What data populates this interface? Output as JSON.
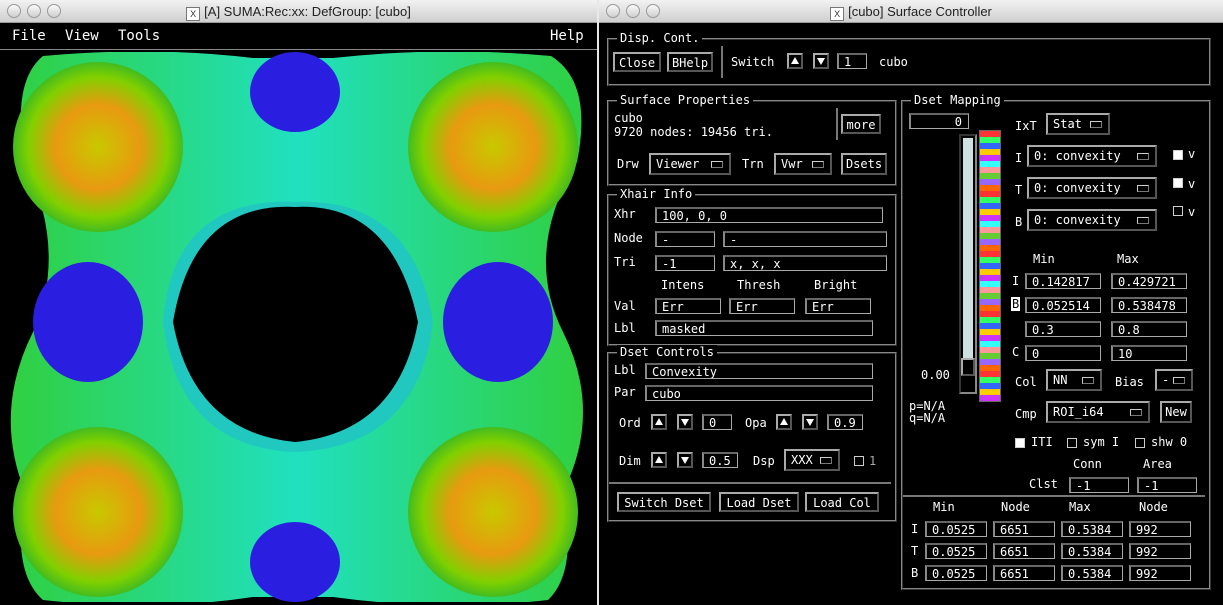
{
  "viewer": {
    "title": "[A] SUMA:Rec:xx: DefGroup: [cubo]",
    "menu": {
      "file": "File",
      "view": "View",
      "tools": "Tools",
      "help": "Help"
    }
  },
  "controller": {
    "title": "[cubo] Surface Controller",
    "disp": {
      "label": "Disp. Cont.",
      "close": "Close",
      "bhelp": "BHelp",
      "switch": "Switch",
      "index": "1",
      "name": "cubo"
    },
    "props": {
      "label": "Surface Properties",
      "surf": "cubo",
      "info": "9720 nodes: 19456 tri.",
      "more": "more",
      "drw": "Drw",
      "drw_val": "Viewer",
      "trn": "Trn",
      "trn_val": "Vwr",
      "dsets": "Dsets"
    },
    "xhair": {
      "label": "Xhair Info",
      "xhr": "Xhr",
      "xhr_val": "100, 0, 0",
      "node": "Node",
      "node_val": "-",
      "node_val2": "-",
      "tri": "Tri",
      "tri_val": "-1",
      "tri_val2": "x, x, x",
      "intens": "Intens",
      "thresh": "Thresh",
      "bright": "Bright",
      "val": "Val",
      "err1": "Err",
      "err2": "Err",
      "err3": "Err",
      "lbl": "Lbl",
      "lbl_val": "masked"
    },
    "dsetc": {
      "label": "Dset Controls",
      "lbl": "Lbl",
      "lbl_val": "Convexity",
      "par": "Par",
      "par_val": "cubo",
      "ord": "Ord",
      "ord_val": "0",
      "opa": "Opa",
      "opa_val": "0.9",
      "dim": "Dim",
      "dim_val": "0.5",
      "dsp": "Dsp",
      "dsp_val": "XXX",
      "one": "1",
      "switch_dset": "Switch Dset",
      "load_dset": "Load Dset",
      "load_col": "Load Col"
    },
    "map": {
      "label": "Dset Mapping",
      "top_val": "0",
      "zero": "0.00",
      "p": "p=N/A",
      "q": "q=N/A",
      "ixt": "IxT",
      "ixt_val": "Stat",
      "i": "I",
      "t": "T",
      "b": "B",
      "conv": "0: convexity",
      "v": "v",
      "min": "Min",
      "max": "Max",
      "i_min": "0.142817",
      "i_max": "0.429721",
      "b_min": "0.052514",
      "b_max": "0.538478",
      "r3_min": "0.3",
      "r3_max": "0.8",
      "c": "C",
      "c_min": "0",
      "c_max": "10",
      "col": "Col",
      "col_val": "NN",
      "bias": "Bias",
      "bias_val": "-",
      "cmp": "Cmp",
      "cmp_val": "ROI_i64",
      "new": "New",
      "iti": "ITI",
      "symi": "sym I",
      "shw0": "shw 0",
      "conn": "Conn",
      "area": "Area",
      "clst": "Clst",
      "clst1": "-1",
      "clst2": "-1",
      "th_min": "Min",
      "th_node": "Node",
      "th_max": "Max",
      "th_node2": "Node",
      "rows": [
        {
          "k": "I",
          "min": "0.0525",
          "node": "6651",
          "max": "0.5384",
          "node2": "992"
        },
        {
          "k": "T",
          "min": "0.0525",
          "node": "6651",
          "max": "0.5384",
          "node2": "992"
        },
        {
          "k": "B",
          "min": "0.0525",
          "node": "6651",
          "max": "0.5384",
          "node2": "992"
        }
      ]
    }
  }
}
